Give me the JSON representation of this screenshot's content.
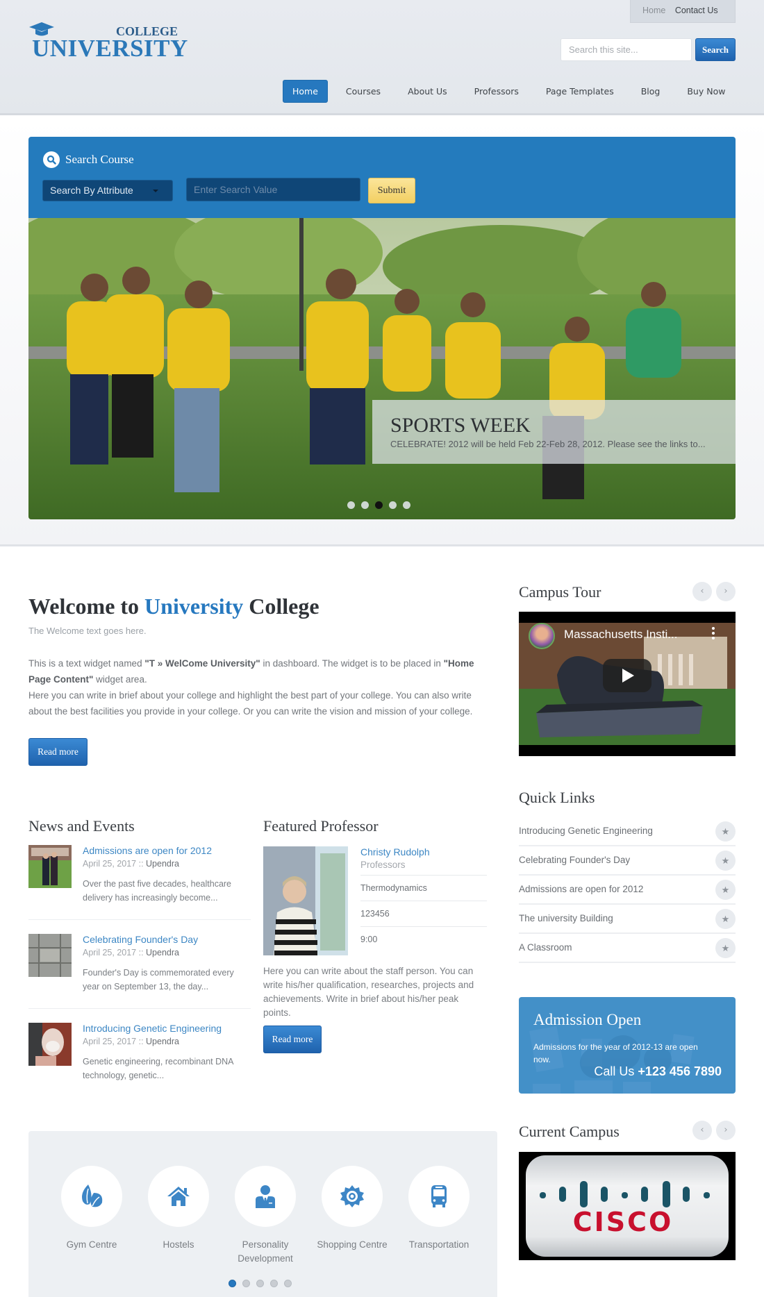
{
  "header": {
    "logo": {
      "top_word": "COLLEGE",
      "main_word": "UNIVERSITY"
    },
    "top_links": [
      {
        "label": "Home"
      },
      {
        "label": "Contact Us"
      }
    ],
    "search": {
      "placeholder": "Search this site...",
      "button_label": "Search"
    },
    "nav": [
      {
        "label": "Home",
        "active": true
      },
      {
        "label": "Courses"
      },
      {
        "label": "About Us"
      },
      {
        "label": "Professors"
      },
      {
        "label": "Page Templates"
      },
      {
        "label": "Blog"
      },
      {
        "label": "Buy Now"
      }
    ]
  },
  "course_search": {
    "title": "Search Course",
    "attribute_select": "Search By Attribute",
    "value_placeholder": "Enter Search Value",
    "submit_label": "Submit"
  },
  "slider": {
    "caption_title": "SPORTS WEEK",
    "caption_text": "CELEBRATE! 2012 will be held Feb 22-Feb 28, 2012. Please see the links to...",
    "slide_count": 5,
    "active_slide": 3
  },
  "welcome": {
    "title_pre": "Welcome to ",
    "title_highlight": "University",
    "title_post": " College",
    "subtitle": "The Welcome text goes here.",
    "p1_a": "This is a text widget named ",
    "p1_b": "\"T » WelCome University\"",
    "p1_c": " in dashboard. The widget is to be placed in ",
    "p1_d": "\"Home Page Content\"",
    "p1_e": " widget area.",
    "p2": "Here you can write in brief about your college and highlight the best part of your college. You can also write about the best facilities you provide in your college. Or you can write the vision and mission of your college.",
    "read_more": "Read more"
  },
  "news": {
    "title": "News and Events",
    "items": [
      {
        "title": "Admissions are open for 2012",
        "date": "April 25, 2017 :: ",
        "author": "Upendra",
        "excerpt": "Over the past five decades, healthcare delivery has increasingly become..."
      },
      {
        "title": "Celebrating Founder's Day",
        "date": "April 25, 2017 :: ",
        "author": "Upendra",
        "excerpt": "Founder's Day is commemorated every year on September 13, the day..."
      },
      {
        "title": "Introducing Genetic Engineering",
        "date": "April 25, 2017 :: ",
        "author": "Upendra",
        "excerpt": "Genetic engineering, recombinant DNA technology, genetic..."
      }
    ]
  },
  "professor": {
    "title": "Featured Professor",
    "name": "Christy Rudolph",
    "role": "Professors",
    "subject": "Thermodynamics",
    "phone": "123456",
    "time": "9:00",
    "description": "Here you can write about the staff person. You can write his/her qualification, researches, projects and achievements. Write in brief about his/her peak points.",
    "read_more": "Read more"
  },
  "campus_tour": {
    "title": "Campus Tour",
    "video_title": "Massachusetts Insti...",
    "prev": "‹",
    "next": "›"
  },
  "quick_links": {
    "title": "Quick Links",
    "items": [
      {
        "label": "Introducing Genetic Engineering"
      },
      {
        "label": "Celebrating Founder's Day"
      },
      {
        "label": "Admissions are open for 2012"
      },
      {
        "label": "The university Building"
      },
      {
        "label": "A Classroom"
      }
    ],
    "icon": "★"
  },
  "admission": {
    "title": "Admission Open",
    "text": "Admissions for the year of 2012-13 are open now.",
    "call_label": "Call Us ",
    "phone": "+123 456 7890"
  },
  "current_campus": {
    "title": "Current Campus",
    "logo_text": "CISCO",
    "prev": "‹",
    "next": "›"
  },
  "facilities": {
    "items": [
      {
        "label": "Gym Centre",
        "icon": "leaf-icon"
      },
      {
        "label": "Hostels",
        "icon": "home-icon"
      },
      {
        "label": "Personality Development",
        "icon": "businessman-icon"
      },
      {
        "label": "Shopping Centre",
        "icon": "sun-gear-icon"
      },
      {
        "label": "Transportation",
        "icon": "bus-icon"
      }
    ],
    "page_count": 5,
    "active_page": 1
  },
  "colors": {
    "brand_blue": "#2678bf",
    "link_blue": "#3d87c4",
    "submit_yellow": "#f5d773",
    "admission_blue": "#4390c8"
  }
}
